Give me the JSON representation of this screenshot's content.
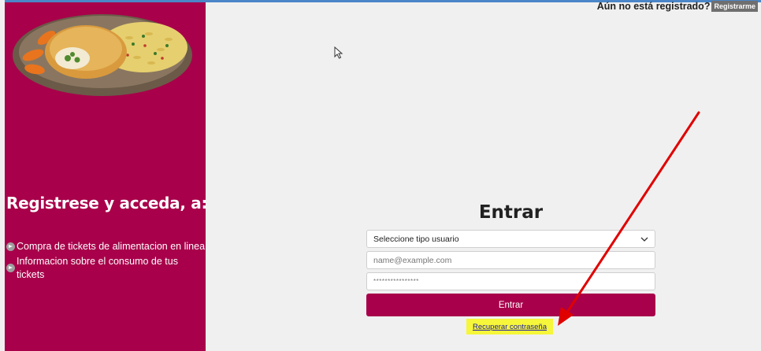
{
  "promo": {
    "heading": "Registrese y acceda, a:",
    "items": [
      "Compra de tickets de alimentacion en linea",
      "Informacion sobre el consumo de tus tickets"
    ],
    "image_icon": "food-plate-image"
  },
  "header": {
    "register_prompt": "Aún no está registrado?",
    "register_button": "Registrarme"
  },
  "login": {
    "title": "Entrar",
    "user_type_selected": "Seleccione tipo usuario",
    "email_placeholder": "name@example.com",
    "password_placeholder": "****************",
    "submit_label": "Entrar",
    "recover_link": "Recuperar contraseña"
  },
  "colors": {
    "brand": "#a8004a",
    "background": "#f0f0f0",
    "highlight": "#f6f63a",
    "annotation_arrow": "#e00000"
  }
}
